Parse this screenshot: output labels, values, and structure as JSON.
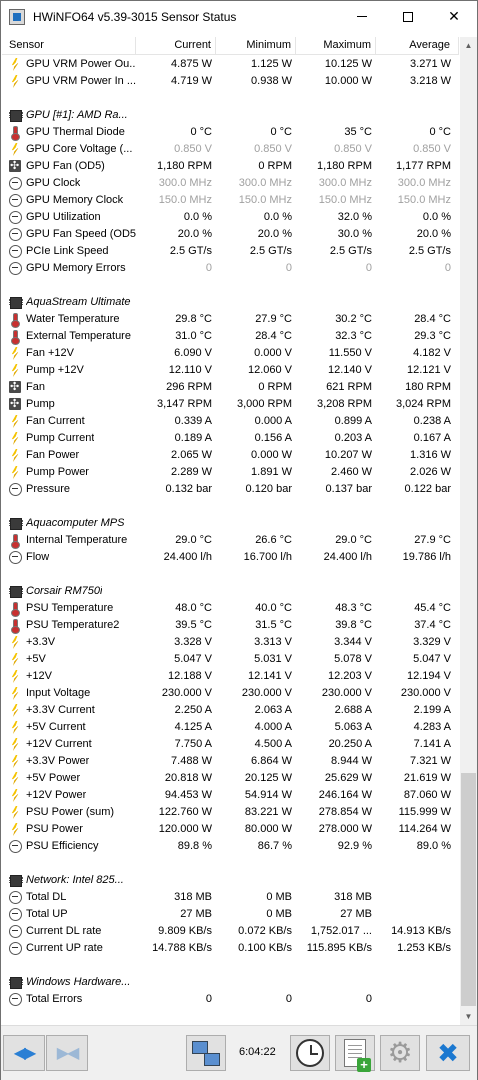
{
  "window": {
    "title": "HWiNFO64 v5.39-3015 Sensor Status"
  },
  "columns": [
    "Sensor",
    "Current",
    "Minimum",
    "Maximum",
    "Average"
  ],
  "rows": [
    {
      "t": "s",
      "icon": "bolt",
      "name": "GPU VRM Power Ou...",
      "cur": "4.875 W",
      "min": "1.125 W",
      "max": "10.125 W",
      "avg": "3.271 W"
    },
    {
      "t": "s",
      "icon": "bolt",
      "name": "GPU VRM Power In ...",
      "cur": "4.719 W",
      "min": "0.938 W",
      "max": "10.000 W",
      "avg": "3.218 W"
    },
    {
      "t": "b"
    },
    {
      "t": "g",
      "icon": "chip",
      "name": "GPU [#1]: AMD Ra..."
    },
    {
      "t": "s",
      "icon": "therm",
      "name": "GPU Thermal Diode",
      "cur": "0 °C",
      "min": "0 °C",
      "max": "35 °C",
      "avg": "0 °C"
    },
    {
      "t": "s",
      "icon": "bolt",
      "name": "GPU Core Voltage (...",
      "cur": "0.850 V",
      "min": "0.850 V",
      "max": "0.850 V",
      "avg": "0.850 V",
      "dim": true
    },
    {
      "t": "s",
      "icon": "fan",
      "name": "GPU Fan (OD5)",
      "cur": "1,180 RPM",
      "min": "0 RPM",
      "max": "1,180 RPM",
      "avg": "1,177 RPM"
    },
    {
      "t": "s",
      "icon": "gauge",
      "name": "GPU Clock",
      "cur": "300.0 MHz",
      "min": "300.0 MHz",
      "max": "300.0 MHz",
      "avg": "300.0 MHz",
      "dim": true
    },
    {
      "t": "s",
      "icon": "gauge",
      "name": "GPU Memory Clock",
      "cur": "150.0 MHz",
      "min": "150.0 MHz",
      "max": "150.0 MHz",
      "avg": "150.0 MHz",
      "dim": true
    },
    {
      "t": "s",
      "icon": "gauge",
      "name": "GPU Utilization",
      "cur": "0.0 %",
      "min": "0.0 %",
      "max": "32.0 %",
      "avg": "0.0 %"
    },
    {
      "t": "s",
      "icon": "gauge",
      "name": "GPU Fan Speed (OD5)",
      "cur": "20.0 %",
      "min": "20.0 %",
      "max": "30.0 %",
      "avg": "20.0 %"
    },
    {
      "t": "s",
      "icon": "gauge",
      "name": "PCIe Link Speed",
      "cur": "2.5 GT/s",
      "min": "2.5 GT/s",
      "max": "2.5 GT/s",
      "avg": "2.5 GT/s"
    },
    {
      "t": "s",
      "icon": "gauge",
      "name": "GPU Memory Errors",
      "cur": "0",
      "min": "0",
      "max": "0",
      "avg": "0",
      "dim": true
    },
    {
      "t": "b"
    },
    {
      "t": "g",
      "icon": "chip",
      "name": "AquaStream Ultimate"
    },
    {
      "t": "s",
      "icon": "therm",
      "name": "Water Temperature",
      "cur": "29.8 °C",
      "min": "27.9 °C",
      "max": "30.2 °C",
      "avg": "28.4 °C"
    },
    {
      "t": "s",
      "icon": "therm",
      "name": "External Temperature",
      "cur": "31.0 °C",
      "min": "28.4 °C",
      "max": "32.3 °C",
      "avg": "29.3 °C"
    },
    {
      "t": "s",
      "icon": "bolt",
      "name": "Fan +12V",
      "cur": "6.090 V",
      "min": "0.000 V",
      "max": "11.550 V",
      "avg": "4.182 V"
    },
    {
      "t": "s",
      "icon": "bolt",
      "name": "Pump +12V",
      "cur": "12.110 V",
      "min": "12.060 V",
      "max": "12.140 V",
      "avg": "12.121 V"
    },
    {
      "t": "s",
      "icon": "fan",
      "name": "Fan",
      "cur": "296 RPM",
      "min": "0 RPM",
      "max": "621 RPM",
      "avg": "180 RPM"
    },
    {
      "t": "s",
      "icon": "fan",
      "name": "Pump",
      "cur": "3,147 RPM",
      "min": "3,000 RPM",
      "max": "3,208 RPM",
      "avg": "3,024 RPM"
    },
    {
      "t": "s",
      "icon": "bolt",
      "name": "Fan Current",
      "cur": "0.339 A",
      "min": "0.000 A",
      "max": "0.899 A",
      "avg": "0.238 A"
    },
    {
      "t": "s",
      "icon": "bolt",
      "name": "Pump Current",
      "cur": "0.189 A",
      "min": "0.156 A",
      "max": "0.203 A",
      "avg": "0.167 A"
    },
    {
      "t": "s",
      "icon": "bolt",
      "name": "Fan Power",
      "cur": "2.065 W",
      "min": "0.000 W",
      "max": "10.207 W",
      "avg": "1.316 W"
    },
    {
      "t": "s",
      "icon": "bolt",
      "name": "Pump Power",
      "cur": "2.289 W",
      "min": "1.891 W",
      "max": "2.460 W",
      "avg": "2.026 W"
    },
    {
      "t": "s",
      "icon": "gauge",
      "name": "Pressure",
      "cur": "0.132 bar",
      "min": "0.120 bar",
      "max": "0.137 bar",
      "avg": "0.122 bar"
    },
    {
      "t": "b"
    },
    {
      "t": "g",
      "icon": "chip",
      "name": "Aquacomputer MPS"
    },
    {
      "t": "s",
      "icon": "therm",
      "name": "Internal Temperature",
      "cur": "29.0 °C",
      "min": "26.6 °C",
      "max": "29.0 °C",
      "avg": "27.9 °C"
    },
    {
      "t": "s",
      "icon": "gauge",
      "name": "Flow",
      "cur": "24.400 l/h",
      "min": "16.700 l/h",
      "max": "24.400 l/h",
      "avg": "19.786 l/h"
    },
    {
      "t": "b"
    },
    {
      "t": "g",
      "icon": "chip",
      "name": "Corsair RM750i"
    },
    {
      "t": "s",
      "icon": "therm",
      "name": "PSU Temperature",
      "cur": "48.0 °C",
      "min": "40.0 °C",
      "max": "48.3 °C",
      "avg": "45.4 °C"
    },
    {
      "t": "s",
      "icon": "therm",
      "name": "PSU Temperature2",
      "cur": "39.5 °C",
      "min": "31.5 °C",
      "max": "39.8 °C",
      "avg": "37.4 °C"
    },
    {
      "t": "s",
      "icon": "bolt",
      "name": "+3.3V",
      "cur": "3.328 V",
      "min": "3.313 V",
      "max": "3.344 V",
      "avg": "3.329 V"
    },
    {
      "t": "s",
      "icon": "bolt",
      "name": "+5V",
      "cur": "5.047 V",
      "min": "5.031 V",
      "max": "5.078 V",
      "avg": "5.047 V"
    },
    {
      "t": "s",
      "icon": "bolt",
      "name": "+12V",
      "cur": "12.188 V",
      "min": "12.141 V",
      "max": "12.203 V",
      "avg": "12.194 V"
    },
    {
      "t": "s",
      "icon": "bolt",
      "name": "Input Voltage",
      "cur": "230.000 V",
      "min": "230.000 V",
      "max": "230.000 V",
      "avg": "230.000 V"
    },
    {
      "t": "s",
      "icon": "bolt",
      "name": "+3.3V Current",
      "cur": "2.250 A",
      "min": "2.063 A",
      "max": "2.688 A",
      "avg": "2.199 A"
    },
    {
      "t": "s",
      "icon": "bolt",
      "name": "+5V Current",
      "cur": "4.125 A",
      "min": "4.000 A",
      "max": "5.063 A",
      "avg": "4.283 A"
    },
    {
      "t": "s",
      "icon": "bolt",
      "name": "+12V Current",
      "cur": "7.750 A",
      "min": "4.500 A",
      "max": "20.250 A",
      "avg": "7.141 A"
    },
    {
      "t": "s",
      "icon": "bolt",
      "name": "+3.3V Power",
      "cur": "7.488 W",
      "min": "6.864 W",
      "max": "8.944 W",
      "avg": "7.321 W"
    },
    {
      "t": "s",
      "icon": "bolt",
      "name": "+5V Power",
      "cur": "20.818 W",
      "min": "20.125 W",
      "max": "25.629 W",
      "avg": "21.619 W"
    },
    {
      "t": "s",
      "icon": "bolt",
      "name": "+12V Power",
      "cur": "94.453 W",
      "min": "54.914 W",
      "max": "246.164 W",
      "avg": "87.060 W"
    },
    {
      "t": "s",
      "icon": "bolt",
      "name": "PSU Power (sum)",
      "cur": "122.760 W",
      "min": "83.221 W",
      "max": "278.854 W",
      "avg": "115.999 W"
    },
    {
      "t": "s",
      "icon": "bolt",
      "name": "PSU Power",
      "cur": "120.000 W",
      "min": "80.000 W",
      "max": "278.000 W",
      "avg": "114.264 W"
    },
    {
      "t": "s",
      "icon": "gauge",
      "name": "PSU Efficiency",
      "cur": "89.8 %",
      "min": "86.7 %",
      "max": "92.9 %",
      "avg": "89.0 %"
    },
    {
      "t": "b"
    },
    {
      "t": "g",
      "icon": "chip",
      "name": "Network: Intel 825..."
    },
    {
      "t": "s",
      "icon": "gauge",
      "name": "Total DL",
      "cur": "318 MB",
      "min": "0 MB",
      "max": "318 MB",
      "avg": ""
    },
    {
      "t": "s",
      "icon": "gauge",
      "name": "Total UP",
      "cur": "27 MB",
      "min": "0 MB",
      "max": "27 MB",
      "avg": ""
    },
    {
      "t": "s",
      "icon": "gauge",
      "name": "Current DL rate",
      "cur": "9.809 KB/s",
      "min": "0.072 KB/s",
      "max": "1,752.017 ...",
      "avg": "14.913 KB/s"
    },
    {
      "t": "s",
      "icon": "gauge",
      "name": "Current UP rate",
      "cur": "14.788 KB/s",
      "min": "0.100 KB/s",
      "max": "115.895 KB/s",
      "avg": "1.253 KB/s"
    },
    {
      "t": "b"
    },
    {
      "t": "g",
      "icon": "chip",
      "name": "Windows Hardware..."
    },
    {
      "t": "s",
      "icon": "gauge",
      "name": "Total Errors",
      "cur": "0",
      "min": "0",
      "max": "0",
      "avg": ""
    }
  ],
  "toolbar": {
    "clock": "6:04:22"
  }
}
